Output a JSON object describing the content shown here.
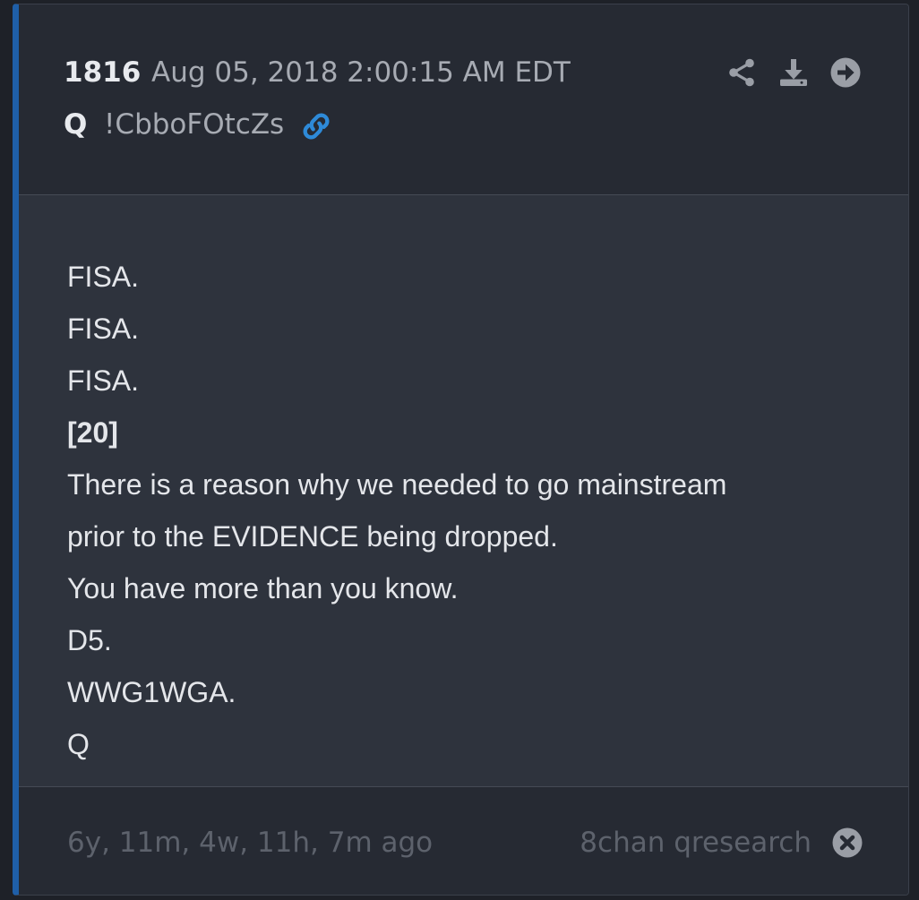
{
  "post": {
    "number": "1816",
    "date": "Aug 05, 2018 2:00:15 AM EDT",
    "author": "Q",
    "tripcode": "!CbboFOtcZs"
  },
  "icons": {
    "link": "link-icon",
    "share": "share-icon",
    "download": "download-icon",
    "goto": "arrow-right-circle-icon",
    "close": "close-circle-icon"
  },
  "colors": {
    "accent_bar": "#1f5fa8",
    "link_icon": "#2e8ad8",
    "text": "#e4e6ea",
    "muted": "#5d626c"
  },
  "lines": [
    {
      "text": "FISA.",
      "bold": false
    },
    {
      "text": "FISA.",
      "bold": false
    },
    {
      "text": "FISA.",
      "bold": false
    },
    {
      "text": "[20]",
      "bold": true
    },
    {
      "text": "There is a reason why we needed to go mainstream",
      "bold": false
    },
    {
      "text": "prior to the EVIDENCE being dropped.",
      "bold": false
    },
    {
      "text": "You have more than you know.",
      "bold": false
    },
    {
      "text": "D5.",
      "bold": false
    },
    {
      "text": "WWG1WGA.",
      "bold": false
    },
    {
      "text": "Q",
      "bold": false
    }
  ],
  "footer": {
    "ago": "6y, 11m, 4w, 11h, 7m ago",
    "source": "8chan qresearch"
  }
}
